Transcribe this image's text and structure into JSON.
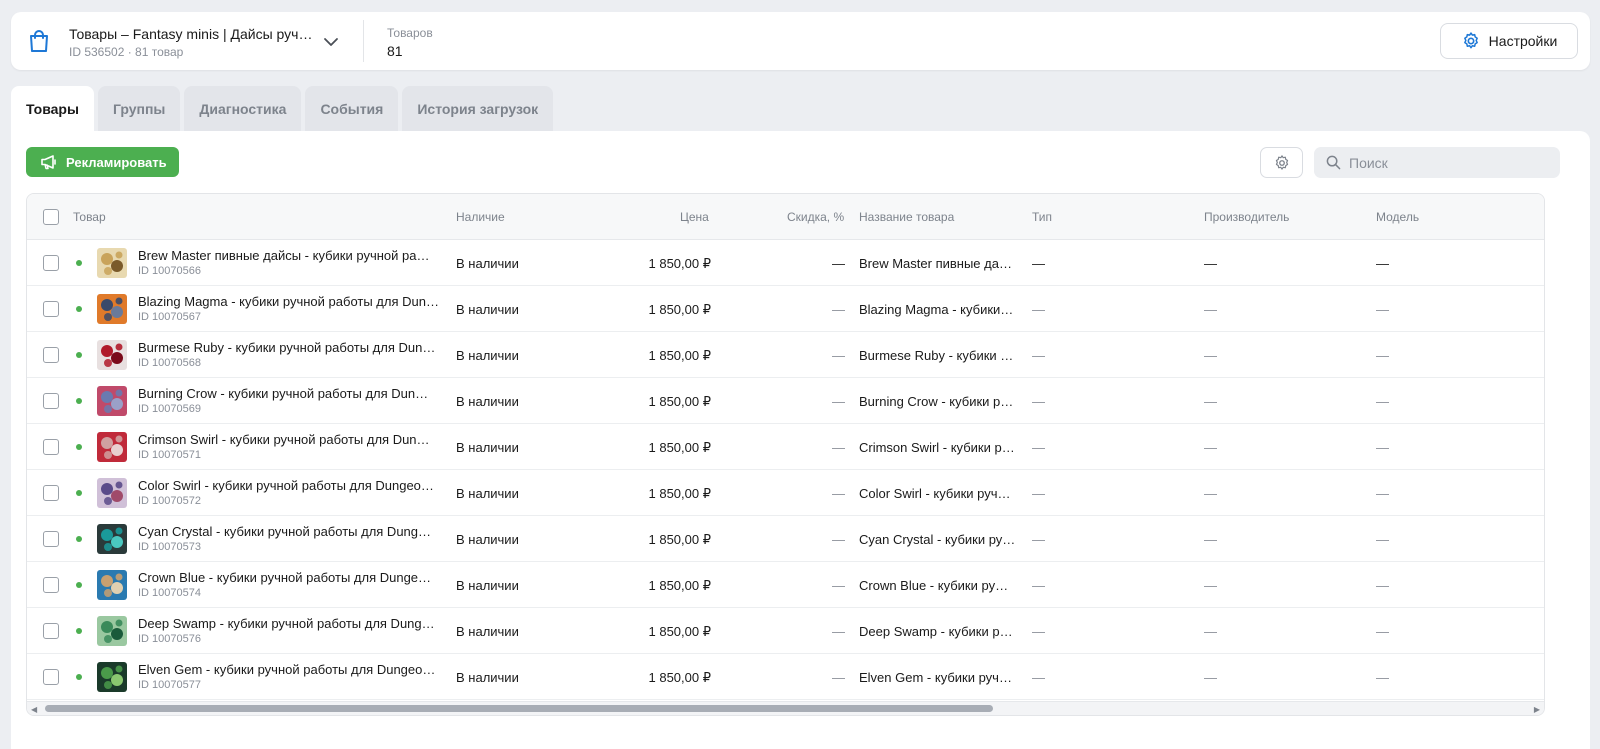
{
  "shop": {
    "title": "Товары – Fantasy minis | Дайсы руч…",
    "subtitle": "ID 536502 · 81 товар",
    "count_label": "Товаров",
    "count_value": "81"
  },
  "header": {
    "settings_label": "Настройки"
  },
  "tabs": [
    {
      "label": "Товары",
      "active": true
    },
    {
      "label": "Группы",
      "active": false
    },
    {
      "label": "Диагностика",
      "active": false
    },
    {
      "label": "События",
      "active": false
    },
    {
      "label": "История загрузок",
      "active": false
    }
  ],
  "toolbar": {
    "promote_label": "Рекламировать",
    "search_placeholder": "Поиск"
  },
  "table": {
    "columns": {
      "product": "Товар",
      "availability": "Наличие",
      "price": "Цена",
      "discount": "Скидка, %",
      "name": "Название товара",
      "type": "Тип",
      "manufacturer": "Производитель",
      "model": "Модель"
    },
    "rows": [
      {
        "name": "Brew Master пивные дайсы - кубики ручной ра…",
        "id": "ID 10070566",
        "availability": "В наличии",
        "price": "1 850,00 ₽",
        "discount": "—",
        "title": "Brew Master пивные да…",
        "type": "—",
        "manufacturer": "—",
        "model": "—",
        "thumb": [
          "#c9a35a",
          "#e8d9b0",
          "#7a5a2a"
        ]
      },
      {
        "name": "Blazing Magma - кубики ручной работы для Dun…",
        "id": "ID 10070567",
        "availability": "В наличии",
        "price": "1 850,00 ₽",
        "discount": "—",
        "title": "Blazing Magma - кубики…",
        "type": "—",
        "manufacturer": "—",
        "model": "—",
        "thumb": [
          "#3a4a6a",
          "#e07a2a",
          "#6a7a9a"
        ]
      },
      {
        "name": "Burmese Ruby - кубики ручной работы для Dun…",
        "id": "ID 10070568",
        "availability": "В наличии",
        "price": "1 850,00 ₽",
        "discount": "—",
        "title": "Burmese Ruby - кубики …",
        "type": "—",
        "manufacturer": "—",
        "model": "—",
        "thumb": [
          "#b01a2a",
          "#e8e0e0",
          "#7a0a1a"
        ]
      },
      {
        "name": "Burning Crow - кубики ручной работы для Dun…",
        "id": "ID 10070569",
        "availability": "В наличии",
        "price": "1 850,00 ₽",
        "discount": "—",
        "title": "Burning Crow - кубики р…",
        "type": "—",
        "manufacturer": "—",
        "model": "—",
        "thumb": [
          "#6a7ab0",
          "#c04a6a",
          "#9aa0c8"
        ]
      },
      {
        "name": "Crimson Swirl - кубики ручной работы для Dun…",
        "id": "ID 10070571",
        "availability": "В наличии",
        "price": "1 850,00 ₽",
        "discount": "—",
        "title": "Crimson Swirl - кубики р…",
        "type": "—",
        "manufacturer": "—",
        "model": "—",
        "thumb": [
          "#d0a0a0",
          "#c02a3a",
          "#e8d0d0"
        ]
      },
      {
        "name": "Color Swirl - кубики ручной работы для Dungeo…",
        "id": "ID 10070572",
        "availability": "В наличии",
        "price": "1 850,00 ₽",
        "discount": "—",
        "title": "Color Swirl - кубики руч…",
        "type": "—",
        "manufacturer": "—",
        "model": "—",
        "thumb": [
          "#5a4a8a",
          "#d0c0d8",
          "#a04a6a"
        ]
      },
      {
        "name": "Cyan Crystal - кубики ручной работы для Dung…",
        "id": "ID 10070573",
        "availability": "В наличии",
        "price": "1 850,00 ₽",
        "discount": "—",
        "title": "Cyan Crystal - кубики ру…",
        "type": "—",
        "manufacturer": "—",
        "model": "—",
        "thumb": [
          "#1a9a9a",
          "#2a3a3a",
          "#4ac8c0"
        ]
      },
      {
        "name": "Crown Blue - кубики ручной работы для Dunge…",
        "id": "ID 10070574",
        "availability": "В наличии",
        "price": "1 850,00 ₽",
        "discount": "—",
        "title": "Crown Blue - кубики ру…",
        "type": "—",
        "manufacturer": "—",
        "model": "—",
        "thumb": [
          "#c8a070",
          "#2a7ab0",
          "#e0d0b0"
        ]
      },
      {
        "name": "Deep Swamp - кубики ручной работы для Dung…",
        "id": "ID 10070576",
        "availability": "В наличии",
        "price": "1 850,00 ₽",
        "discount": "—",
        "title": "Deep Swamp - кубики р…",
        "type": "—",
        "manufacturer": "—",
        "model": "—",
        "thumb": [
          "#3a8a5a",
          "#9ac8a0",
          "#1a5a3a"
        ]
      },
      {
        "name": "Elven Gem - кубики ручной работы для Dungeo…",
        "id": "ID 10070577",
        "availability": "В наличии",
        "price": "1 850,00 ₽",
        "discount": "—",
        "title": "Elven Gem - кубики руч…",
        "type": "—",
        "manufacturer": "—",
        "model": "—",
        "thumb": [
          "#4a9a4a",
          "#1a3a2a",
          "#8ac870"
        ]
      }
    ]
  },
  "colors": {
    "accent_blue": "#1e78d6",
    "promote_green": "#4caf50",
    "status_dot": "#4caf50"
  }
}
